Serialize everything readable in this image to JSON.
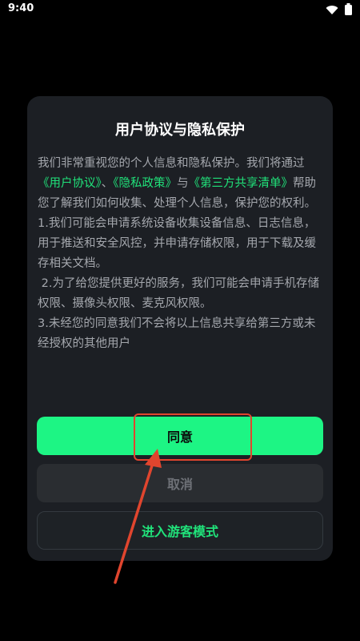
{
  "status_bar": {
    "time": "9:40",
    "icons": [
      "wifi-icon",
      "battery-icon"
    ]
  },
  "dialog": {
    "title": "用户协议与隐私保护",
    "intro_before": "我们非常重视您的个人信息和隐私保护。我们将通过",
    "link_user_agreement": "《用户协议》",
    "sep1": "、",
    "link_privacy_policy": "《隐私政策》",
    "sep2": "与",
    "link_third_party": "《第三方共享清单》",
    "intro_after": "帮助您了解我们如何收集、处理个人信息，保护您的权利。",
    "item1": "1.我们可能会申请系统设备收集设备信息、日志信息，用于推送和安全风控，并申请存储权限，用于下载及缓存相关文档。",
    "item2": " 2.为了给您提供更好的服务，我们可能会申请手机存储权限、摄像头权限、麦克风权限。",
    "item3": "3.未经您的同意我们不会将以上信息共享给第三方或未经授权的其他用户"
  },
  "buttons": {
    "agree": "同意",
    "cancel": "取消",
    "guest": "进入游客模式"
  },
  "colors": {
    "accent": "#1df584",
    "link": "#20e27a",
    "annotation": "#e0452e",
    "dialog_bg": "#1c1f24"
  }
}
